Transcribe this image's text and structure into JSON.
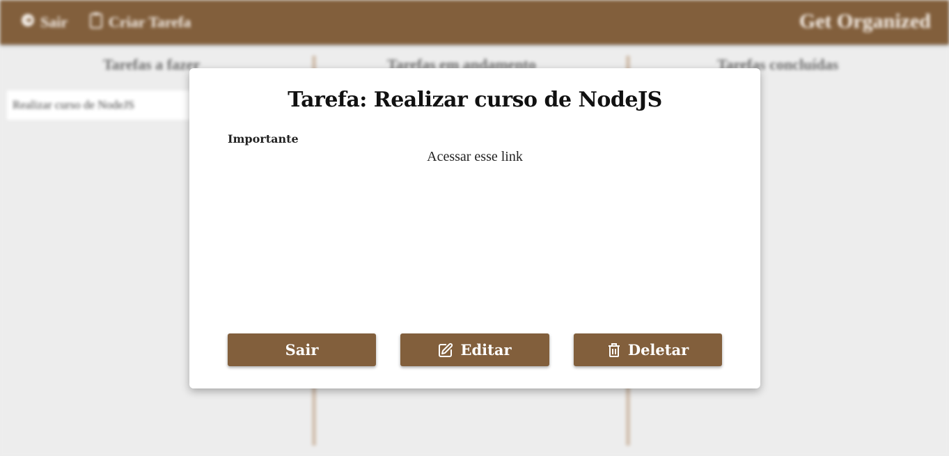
{
  "background": {
    "topbar": {
      "exit_label": "Sair",
      "create_label": "Criar Tarefa",
      "brand": "Get Organized"
    },
    "columns": [
      {
        "title": "Tarefas a fazer"
      },
      {
        "title": "Tarefas em andamento"
      },
      {
        "title": "Tarefas concluídas"
      }
    ],
    "todo_card": "Realizar curso de NodeJS"
  },
  "modal": {
    "title": "Tarefa: Realizar curso de NodeJS",
    "priority": "Importante",
    "description": "Acessar esse link",
    "buttons": {
      "exit": "Sair",
      "edit": "Editar",
      "delete": "Deletar"
    }
  },
  "icons": {
    "exit": "exit-icon",
    "create": "clipboard-icon",
    "edit": "edit-icon",
    "delete": "trash-icon"
  },
  "colors": {
    "brand_brown": "#825f3c",
    "background": "#ededed",
    "modal_bg": "#ffffff"
  }
}
